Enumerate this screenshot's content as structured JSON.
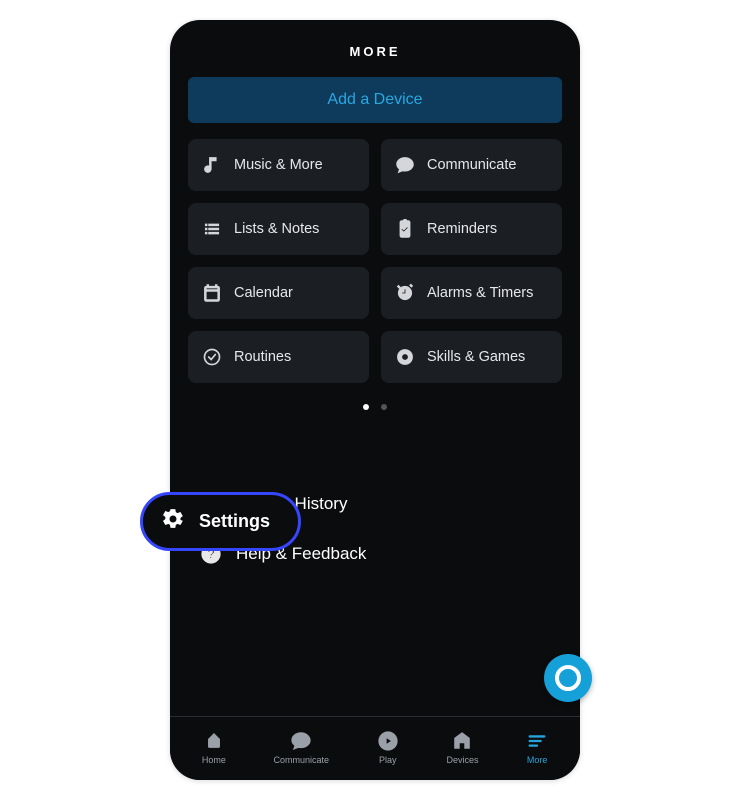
{
  "header": {
    "title": "MORE"
  },
  "add_device": {
    "label": "Add a Device"
  },
  "tiles": [
    {
      "label": "Music & More"
    },
    {
      "label": "Communicate"
    },
    {
      "label": "Lists & Notes"
    },
    {
      "label": "Reminders"
    },
    {
      "label": "Calendar"
    },
    {
      "label": "Alarms & Timers"
    },
    {
      "label": "Routines"
    },
    {
      "label": "Skills & Games"
    }
  ],
  "pager": {
    "pages": 2,
    "active": 0
  },
  "list": {
    "settings": "Settings",
    "activity_history": "Activity History",
    "help_feedback": "Help & Feedback"
  },
  "nav": {
    "home": "Home",
    "communicate": "Communicate",
    "play": "Play",
    "devices": "Devices",
    "more": "More"
  },
  "colors": {
    "accent": "#15a0d8",
    "highlight_border": "#3646ff",
    "tile_bg": "#1b1f24",
    "add_device_bg": "#0e3a5c",
    "add_device_text": "#2aa7e0"
  }
}
